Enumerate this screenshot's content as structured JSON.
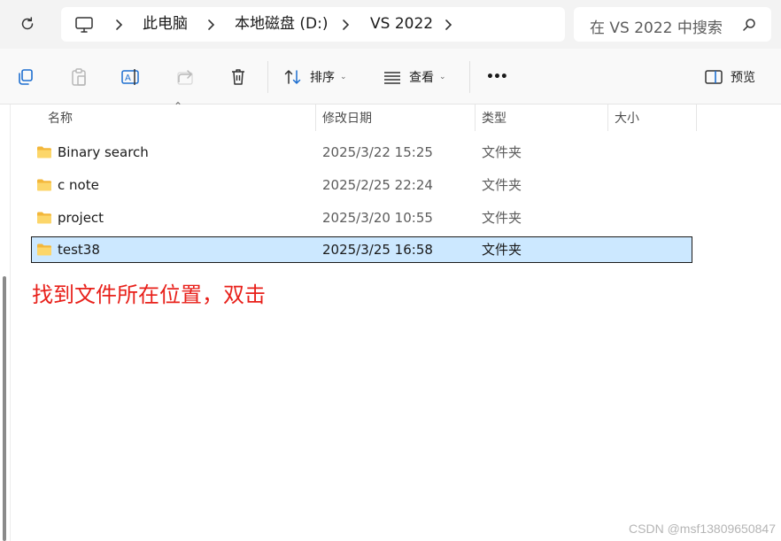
{
  "address_bar": {
    "crumbs": [
      "此电脑",
      "本地磁盘 (D:)",
      "VS 2022"
    ],
    "icon": "computer-icon"
  },
  "search": {
    "placeholder": "在 VS 2022 中搜索"
  },
  "toolbar": {
    "sort_label": "排序",
    "view_label": "查看",
    "more_label": "•••",
    "preview_label": "预览",
    "icons": [
      "copy-icon",
      "paste-icon",
      "rename-icon",
      "share-icon",
      "delete-icon",
      "sort-icon",
      "view-icon",
      "more-icon",
      "preview-pane-icon"
    ]
  },
  "columns": {
    "name": "名称",
    "date": "修改日期",
    "type": "类型",
    "size": "大小"
  },
  "files": [
    {
      "name": "Binary search",
      "date": "2025/3/22 15:25",
      "type": "文件夹",
      "size": "",
      "selected": false
    },
    {
      "name": "c note",
      "date": "2025/2/25 22:24",
      "type": "文件夹",
      "size": "",
      "selected": false
    },
    {
      "name": "project",
      "date": "2025/3/20 10:55",
      "type": "文件夹",
      "size": "",
      "selected": false
    },
    {
      "name": "test38",
      "date": "2025/3/25 16:58",
      "type": "文件夹",
      "size": "",
      "selected": true
    }
  ],
  "annotation": "找到文件所在位置，双击",
  "watermark": "CSDN @msf13809650847",
  "colors": {
    "selection": "#cce8ff",
    "annotation": "#e8201a",
    "folder": "#f7c948"
  }
}
